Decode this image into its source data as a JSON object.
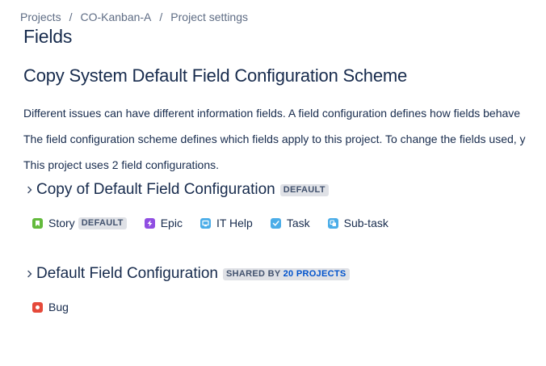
{
  "breadcrumbs": [
    "Projects",
    "CO-Kanban-A",
    "Project settings"
  ],
  "breadcrumb_separator": "/",
  "page_title": "Fields",
  "scheme_title": "Copy System Default Field Configuration Scheme",
  "descriptions": [
    "Different issues can have different information fields. A field configuration defines how fields behave",
    "The field configuration scheme defines which fields apply to this project. To change the fields used, y",
    "This project uses 2 field configurations."
  ],
  "sections": [
    {
      "title": "Copy of Default Field Configuration",
      "badge": "DEFAULT",
      "issue_types": [
        {
          "name": "Story",
          "icon": "story-icon",
          "color": "#63ba3c",
          "badge": "DEFAULT"
        },
        {
          "name": "Epic",
          "icon": "epic-icon",
          "color": "#904ee2"
        },
        {
          "name": "IT Help",
          "icon": "it-help-icon",
          "color": "#4bade8"
        },
        {
          "name": "Task",
          "icon": "task-icon",
          "color": "#4bade8"
        },
        {
          "name": "Sub-task",
          "icon": "subtask-icon",
          "color": "#4bade8"
        }
      ]
    },
    {
      "title": "Default Field Configuration",
      "badge_prefix": "SHARED BY",
      "badge_count": "20 PROJECTS",
      "issue_types": [
        {
          "name": "Bug",
          "icon": "bug-icon",
          "color": "#e5493a"
        }
      ]
    }
  ],
  "colors": {
    "text": "#172b4d",
    "subtle_text": "#5e6c84",
    "lozenge_bg": "#dfe1e6",
    "lozenge_text": "#42526e",
    "link": "#0052cc"
  }
}
